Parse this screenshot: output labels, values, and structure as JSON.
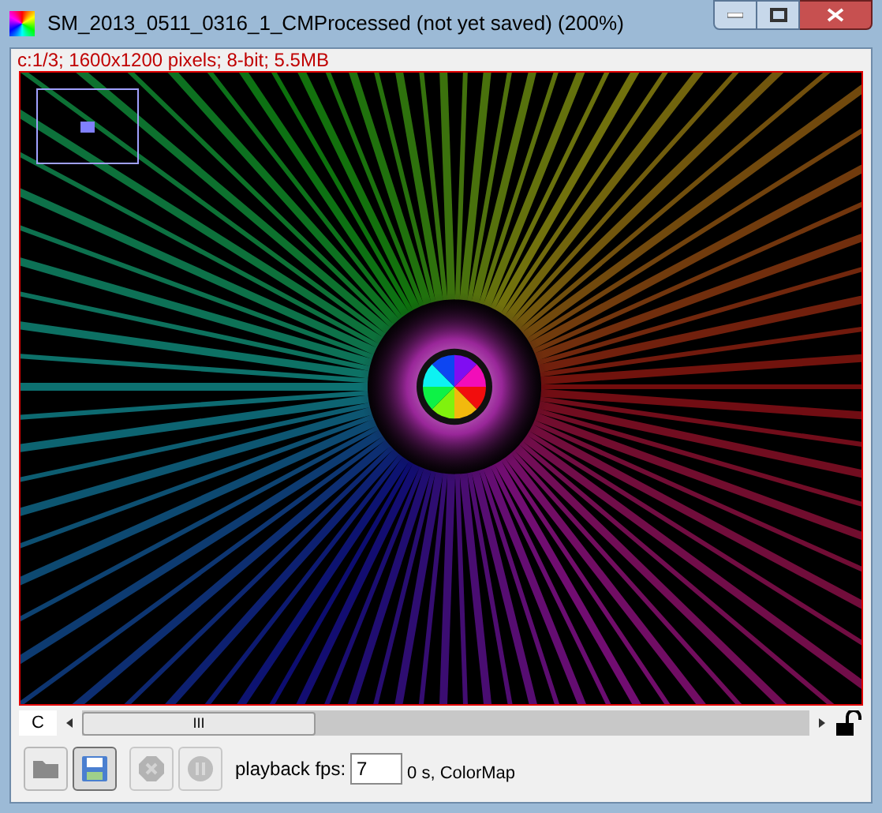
{
  "window": {
    "title": "SM_2013_0511_0316_1_CMProcessed (not yet saved) (200%)"
  },
  "info": "c:1/3; 1600x1200 pixels; 8-bit; 5.5MB",
  "scrollbar": {
    "label": "C",
    "thumb": "III"
  },
  "toolbar": {
    "buttons": [
      {
        "kind": "folder",
        "selected": false,
        "disabled": false
      },
      {
        "kind": "save",
        "selected": true,
        "disabled": false
      },
      {
        "kind": "stop",
        "selected": false,
        "disabled": true
      },
      {
        "kind": "pause",
        "selected": false,
        "disabled": true
      }
    ],
    "fps_label": "playback fps:",
    "fps_value": "7",
    "status": "0 s, ColorMap"
  }
}
